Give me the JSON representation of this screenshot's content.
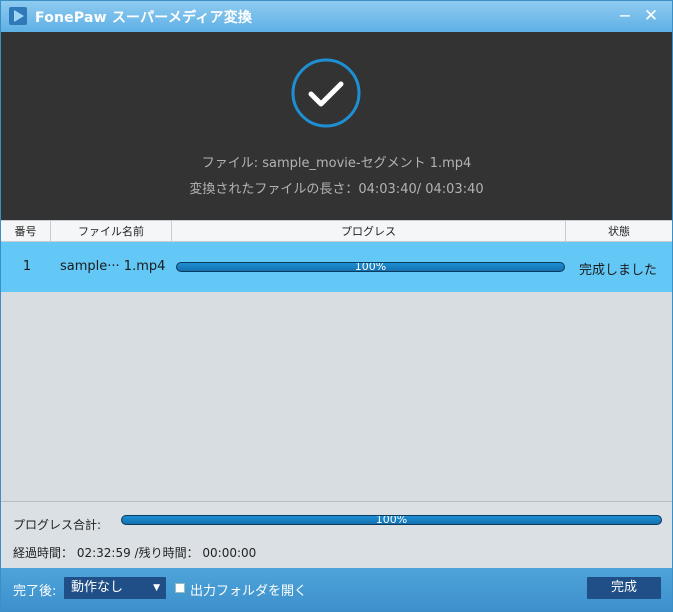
{
  "titlebar": {
    "title": "FonePaw スーパーメディア変換",
    "minimize_glyph": "−",
    "close_glyph": "✕",
    "logo_icon": "app-logo-icon"
  },
  "hero": {
    "status_icon": "check-circle-icon",
    "file_line": "ファイル: sample_movie-セグメント 1.mp4",
    "length_line": "変換されたファイルの長さ：04:03:40/ 04:03:40"
  },
  "table": {
    "headers": {
      "no": "番号",
      "name": "ファイル名前",
      "progress": "プログレス",
      "status": "状態"
    },
    "rows": [
      {
        "no": "1",
        "name": "sample··· 1.mp4",
        "progress": 1.0,
        "progress_label": "100%",
        "status": "完成しました"
      }
    ]
  },
  "summary": {
    "label": "プログレス合計:",
    "progress": 1.0,
    "progress_label": "100%",
    "time_line": "経過時間： 02:32:59 /残り時間： 00:00:00"
  },
  "bottom": {
    "after_label": "完了後:",
    "after_select_value": "動作なし",
    "open_folder_label": "出力フォルダを開く",
    "open_folder_checked": false,
    "done_button": "完成"
  },
  "colors": {
    "titlebar": "#6dbbec",
    "hero_bg": "#333333",
    "check_ring": "#1e8fd2",
    "row_selected": "#63c8f6",
    "progress_fill": "#1a7fc2",
    "button_dark": "#1f4f86"
  }
}
